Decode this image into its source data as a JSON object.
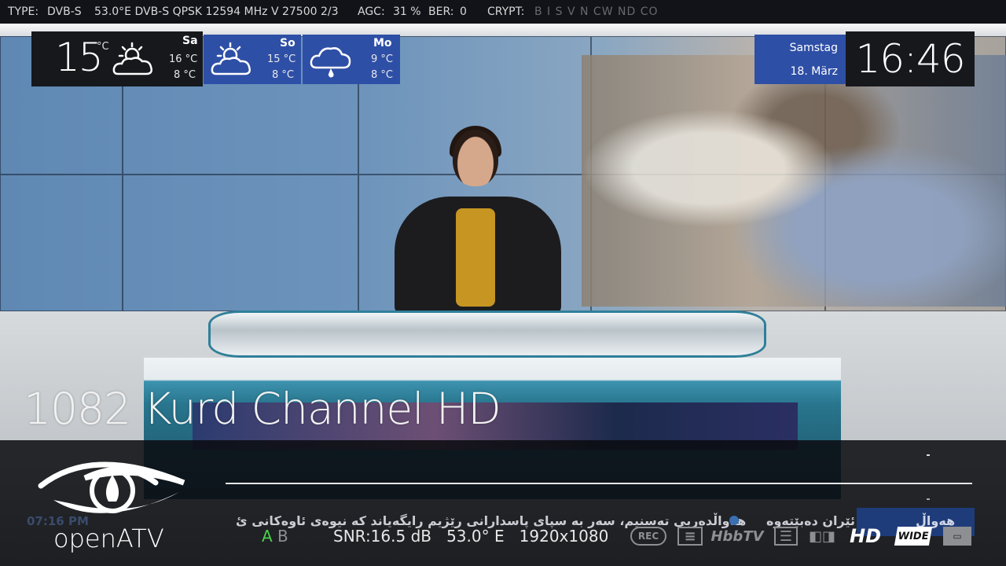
{
  "topbar": {
    "type_label": "TYPE:",
    "type_value": "DVB-S",
    "tuner": "53.0°E DVB-S QPSK 12594 MHz V 27500 2/3",
    "agc_label": "AGC:",
    "agc_value": "31 %",
    "ber_label": "BER:",
    "ber_value": "0",
    "crypt_label": "CRYPT:",
    "crypt_flags": "B I S V N CW ND CO"
  },
  "weather": {
    "current_temp": "15",
    "current_unit": "°C",
    "current_icon": "partly-cloudy-icon",
    "days": [
      {
        "name": "Sa",
        "high": "16 °C",
        "low": "8 °C",
        "icon": "partly-cloudy-icon"
      },
      {
        "name": "So",
        "high": "15 °C",
        "low": "8 °C",
        "icon": "partly-cloudy-icon"
      },
      {
        "name": "Mo",
        "high": "9 °C",
        "low": "8 °C",
        "icon": "rain-cloud-icon"
      }
    ]
  },
  "date": {
    "weekday": "Samstag",
    "day": "18. März"
  },
  "clock": "16:46",
  "channel": {
    "name": "1082 Kurd Channel HD"
  },
  "ticker": {
    "time": "07:16 PM",
    "text": "هەواڵدەربی تەسنیم، سەر بە سپای پاسدارانی رێژیم رایگەیاند کە نیوەی ئاوەکانی ئ",
    "text2": "ئێران دەبێتەوە",
    "logo": "هەواڵ"
  },
  "brand": {
    "name": "openATV"
  },
  "audio": {
    "a": "A",
    "b": "B",
    "active_color": "#4cd04c",
    "inactive_color": "#8d8f93"
  },
  "signal": {
    "snr": "SNR:16.5 dB",
    "orbital": "53.0° E",
    "resolution": "1920x1080"
  },
  "status_icons": {
    "rec": "REC",
    "hbbtv": "HbbTV",
    "hd": "HD",
    "wide": "WIDE",
    "icons": [
      "rec-icon",
      "teletext-icon",
      "hbbtv-icon",
      "epg-icon",
      "dolby-icon",
      "hd-icon",
      "widescreen-icon",
      "subtitle-icon"
    ]
  }
}
